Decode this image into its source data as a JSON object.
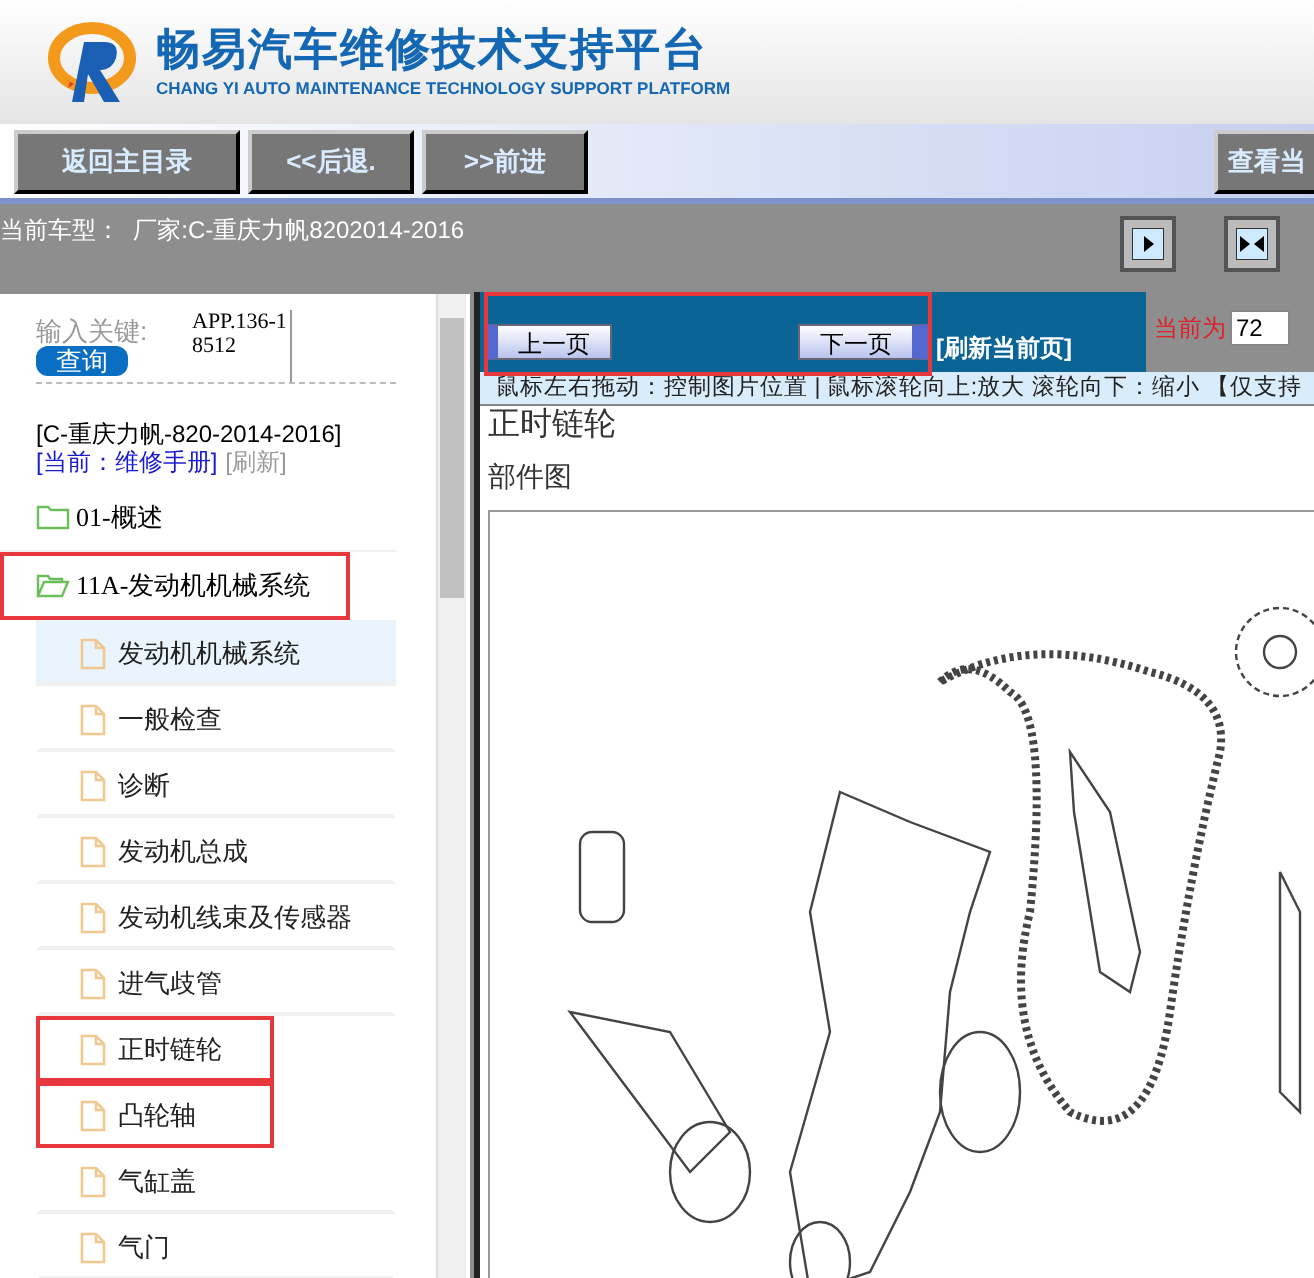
{
  "header": {
    "title": "畅易汽车维修技术支持平台",
    "subtitle": "CHANG YI AUTO MAINTENANCE TECHNOLOGY SUPPORT PLATFORM"
  },
  "toolbar": {
    "buttons": [
      "返回主目录",
      "<<后退.",
      ">>前进"
    ],
    "right_button": "查看当"
  },
  "model_bar": {
    "text": "当前车型：  厂家:C-重庆力帆8202014-2016"
  },
  "search": {
    "label": "输入关键:",
    "button": "查询",
    "value": "APP.136-18512"
  },
  "vehicle": {
    "name": "[C-重庆力帆-820-2014-2016]",
    "current": "[当前：维修手册]",
    "refresh": "[刷新]"
  },
  "tree": [
    {
      "label": "01-概述",
      "expanded": false,
      "highlighted": false
    },
    {
      "label": "11A-发动机机械系统",
      "expanded": true,
      "highlighted": true,
      "children": [
        {
          "label": "发动机机械系统",
          "selected": true,
          "highlighted": false
        },
        {
          "label": "一般检查",
          "selected": false,
          "highlighted": false
        },
        {
          "label": "诊断",
          "selected": false,
          "highlighted": false
        },
        {
          "label": "发动机总成",
          "selected": false,
          "highlighted": false
        },
        {
          "label": "发动机线束及传感器",
          "selected": false,
          "highlighted": false
        },
        {
          "label": "进气歧管",
          "selected": false,
          "highlighted": false
        },
        {
          "label": "正时链轮",
          "selected": false,
          "highlighted": true
        },
        {
          "label": "凸轮轴",
          "selected": false,
          "highlighted": true
        },
        {
          "label": "气缸盖",
          "selected": false,
          "highlighted": false
        },
        {
          "label": "气门",
          "selected": false,
          "highlighted": false
        }
      ]
    }
  ],
  "pager": {
    "prev": "上一页",
    "next": "下一页",
    "highlighted": true,
    "refresh": "[刷新当前页]",
    "current_label": "当前为",
    "current_value": "72"
  },
  "hint": "鼠标左右拖动：控制图片位置 | 鼠标滚轮向上:放大  滚轮向下：缩小 【仅支持",
  "content": {
    "title": "正时链轮",
    "subtitle": "部件图"
  }
}
